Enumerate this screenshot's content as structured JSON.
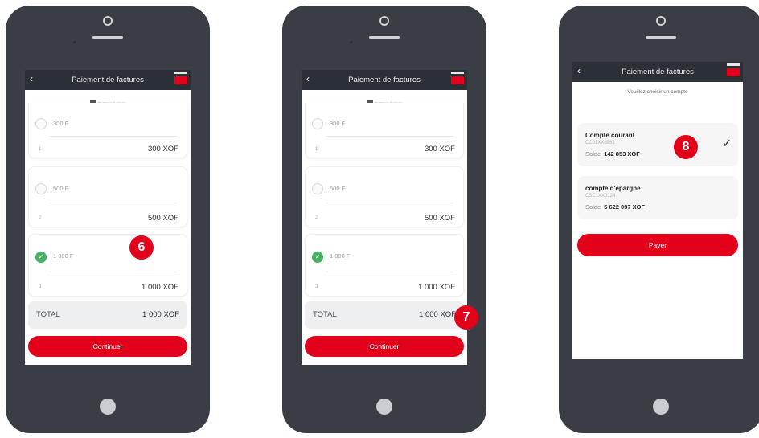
{
  "app": {
    "title": "Paiement de factures"
  },
  "bills_screen": {
    "subtab_label": "Factures à payer",
    "bills": [
      {
        "label": "300 F",
        "index": "1",
        "amount": "300 XOF",
        "checked": false
      },
      {
        "label": "500 F",
        "index": "2",
        "amount": "500 XOF",
        "checked": false
      },
      {
        "label": "1 000 F",
        "index": "3",
        "amount": "1 000 XOF",
        "checked": true
      }
    ],
    "total_label": "TOTAL",
    "total_value": "1 000 XOF",
    "continue_label": "Continuer"
  },
  "accounts_screen": {
    "prompt": "Veuillez choisir un compte",
    "balance_label": "Solde",
    "accounts": [
      {
        "name": "Compte courant",
        "number": "CC01XX5861",
        "balance": "142 853 XOF",
        "selected": true
      },
      {
        "name": "compte d'épargne",
        "number": "CSC1XX0124",
        "balance": "5 622 097 XOF",
        "selected": false
      }
    ],
    "pay_label": "Payer"
  },
  "badges": {
    "step6": "6",
    "step7": "7",
    "step8": "8"
  },
  "colors": {
    "brand_red": "#e2001a",
    "check_green": "#48b062",
    "phone_body": "#3a3e44",
    "header_dark": "#2b2f36"
  }
}
